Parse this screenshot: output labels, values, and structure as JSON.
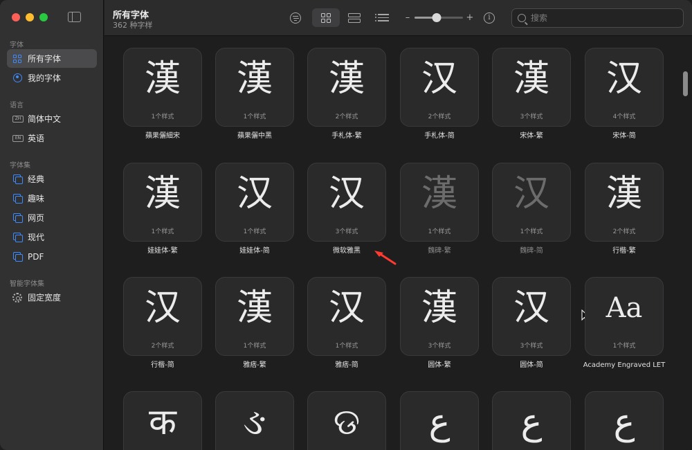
{
  "sidebar": {
    "sections": {
      "fonts": "字体",
      "language": "语言",
      "collections": "字体集",
      "smart": "智能字体集"
    },
    "items": [
      {
        "label": "所有字体",
        "icon": "grid-icon",
        "active": true
      },
      {
        "label": "我的字体",
        "icon": "person-icon"
      },
      {
        "label": "简体中文",
        "icon": "zh-badge-icon",
        "badge": "ZH"
      },
      {
        "label": "英语",
        "icon": "en-badge-icon",
        "badge": "EN"
      },
      {
        "label": "经典",
        "icon": "collection-icon"
      },
      {
        "label": "趣味",
        "icon": "collection-icon"
      },
      {
        "label": "网页",
        "icon": "collection-icon"
      },
      {
        "label": "现代",
        "icon": "collection-icon"
      },
      {
        "label": "PDF",
        "icon": "collection-icon"
      },
      {
        "label": "固定宽度",
        "icon": "gear-icon"
      }
    ]
  },
  "toolbar": {
    "title": "所有字体",
    "subtitle": "362 种字样",
    "zoom_minus": "–",
    "zoom_plus": "+",
    "zoom_level": 0.45,
    "info": "i",
    "search_placeholder": "搜索"
  },
  "fonts": [
    {
      "glyph": "漢",
      "count": "1个样式",
      "name": "蘋果儷細宋"
    },
    {
      "glyph": "漢",
      "count": "1个样式",
      "name": "蘋果儷中黑"
    },
    {
      "glyph": "漢",
      "count": "2个样式",
      "name": "手札体-繁"
    },
    {
      "glyph": "汉",
      "count": "2个样式",
      "name": "手札体-简"
    },
    {
      "glyph": "漢",
      "count": "3个样式",
      "name": "宋体-繁"
    },
    {
      "glyph": "汉",
      "count": "4个样式",
      "name": "宋体-简"
    },
    {
      "glyph": "漢",
      "count": "1个样式",
      "name": "娃娃体-繁"
    },
    {
      "glyph": "汉",
      "count": "1个样式",
      "name": "娃娃体-简"
    },
    {
      "glyph": "汉",
      "count": "3个样式",
      "name": "微软雅黑"
    },
    {
      "glyph": "漢",
      "count": "1个样式",
      "name": "魏碑-繁",
      "dim": true
    },
    {
      "glyph": "汉",
      "count": "1个样式",
      "name": "魏碑-简",
      "dim": true
    },
    {
      "glyph": "漢",
      "count": "2个样式",
      "name": "行楷-繁"
    },
    {
      "glyph": "汉",
      "count": "2个样式",
      "name": "行楷-简"
    },
    {
      "glyph": "漢",
      "count": "1个样式",
      "name": "雅痞-繁"
    },
    {
      "glyph": "汉",
      "count": "1个样式",
      "name": "雅痞-简"
    },
    {
      "glyph": "漢",
      "count": "3个样式",
      "name": "圆体-繁"
    },
    {
      "glyph": "汉",
      "count": "3个样式",
      "name": "圆体-简"
    },
    {
      "glyph": "Aa",
      "count": "1个样式",
      "name": "Academy Engraved LET"
    },
    {
      "glyph": "क",
      "count": "",
      "name": ""
    },
    {
      "glyph": "ઙ",
      "count": "",
      "name": ""
    },
    {
      "glyph": "ଡ",
      "count": "",
      "name": ""
    },
    {
      "glyph": "ع",
      "count": "",
      "name": ""
    },
    {
      "glyph": "ع",
      "count": "",
      "name": ""
    },
    {
      "glyph": "ع",
      "count": "",
      "name": ""
    }
  ],
  "colors": {
    "accent": "#3d8bfd",
    "annotation_arrow": "#ff3b30"
  }
}
